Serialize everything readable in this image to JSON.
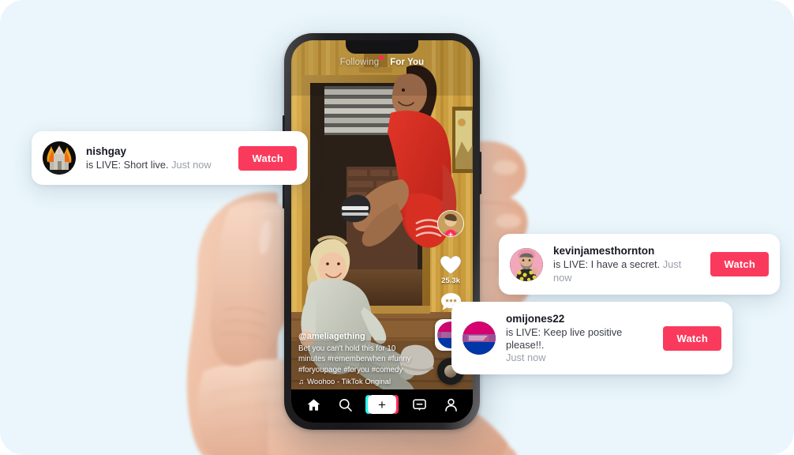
{
  "page": {
    "background_color": "#eaf6fb",
    "corner_radius_px": 30
  },
  "phone": {
    "device_frame": "smartphone-with-notch",
    "app": "TikTok",
    "top_nav": {
      "items": [
        {
          "label": "Following",
          "active": false,
          "has_live_dot": true
        },
        {
          "label": "For You",
          "active": true,
          "has_live_dot": false
        }
      ]
    },
    "video": {
      "handle": "@ameliagething",
      "description": "Bet you can't hold this for 10 minutes #rememberwhen #funny #foryoupage #foryou #comedy",
      "music_note_icon": "music-note-icon",
      "music": "Woohoo - TikTok Original",
      "scene_description": "two people posing in a doorway with yellow striped wallpaper"
    },
    "right_rail": {
      "avatar_label": "creator-avatar",
      "follow_plus": "+",
      "like_icon": "heart-icon",
      "like_count": "25.3k",
      "comment_icon": "comment-bubble-icon",
      "live_thumbnail_label": "live-stream-thumbnail",
      "disc_icon": "spinning-record-icon"
    },
    "tabbar": {
      "items": [
        {
          "name": "home",
          "icon": "home-icon",
          "label": "Home"
        },
        {
          "name": "discover",
          "icon": "search-icon",
          "label": "Discover"
        },
        {
          "name": "create",
          "icon": "plus-icon",
          "label": "+"
        },
        {
          "name": "inbox",
          "icon": "inbox-icon",
          "label": "Inbox"
        },
        {
          "name": "profile",
          "icon": "person-icon",
          "label": "Profile"
        }
      ]
    }
  },
  "notifications": [
    {
      "username": "nishgay",
      "message": "is LIVE: Short live.",
      "time": "Just now",
      "button_label": "Watch",
      "avatar": "burning-church-avatar"
    },
    {
      "username": "kevinjamesthornton",
      "message": "is LIVE: I have a secret.",
      "time": "Just now",
      "button_label": "Watch",
      "avatar": "bearded-man-pink-background-avatar"
    },
    {
      "username": "omijones22",
      "message": "is LIVE: Keep live positive please!!.",
      "time": "Just now",
      "button_label": "Watch",
      "avatar": "bi-pride-flag-avatar"
    }
  ],
  "colors": {
    "accent_red": "#fa3a5c",
    "tiktok_cyan": "#25f4ee",
    "tiktok_pink": "#fe2c55",
    "background": "#eaf6fb",
    "card_white": "#ffffff"
  }
}
